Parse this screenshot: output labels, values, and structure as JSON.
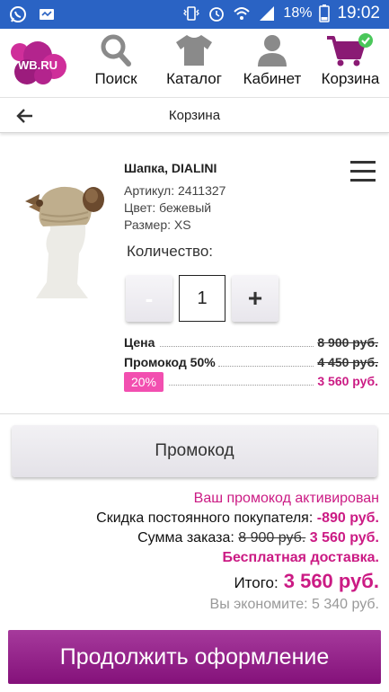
{
  "status_bar": {
    "battery": "18%",
    "time": "19:02"
  },
  "logo": {
    "text": "WB.RU"
  },
  "nav": {
    "search": "Поиск",
    "catalog": "Каталог",
    "cabinet": "Кабинет",
    "cart": "Корзина"
  },
  "page": {
    "title": "Корзина"
  },
  "product": {
    "name": "Шапка, DIALINI",
    "article": "Артикул: 2411327",
    "color": "Цвет: бежевый",
    "size": "Размер: XS",
    "quantity_label": "Количество:",
    "quantity_value": "1",
    "minus_label": "-",
    "plus_label": "+"
  },
  "prices": {
    "price_label": "Цена",
    "price_value": "8 900 руб.",
    "promo_label": "Промокод 50%",
    "promo_value": "4 450 руб.",
    "discount_badge": "20%",
    "final_value": "3 560 руб."
  },
  "promo_button": "Промокод",
  "summary": {
    "activated": "Ваш промокод активирован",
    "loyal_label": "Скидка постоянного покупателя:",
    "loyal_value": "-890 руб.",
    "order_label": "Сумма заказа:",
    "order_old": "8 900 руб.",
    "order_new": "3 560 руб.",
    "delivery": "Бесплатная доставка.",
    "total_label": "Итого:",
    "total_value": "3 560 руб.",
    "save_label": "Вы экономите:",
    "save_value": "5 340 руб."
  },
  "continue_button": "Продолжить оформление",
  "colors": {
    "status_bar": "#2a63c4",
    "accent": "#cb1b84",
    "badge": "#f24fb0",
    "continue": "#94228a"
  }
}
